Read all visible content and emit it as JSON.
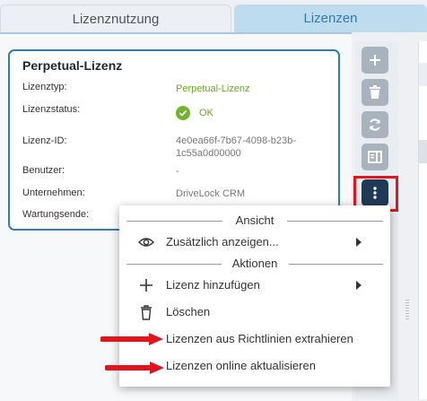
{
  "tabs": [
    {
      "label": "Lizenznutzung"
    },
    {
      "label": "Lizenzen"
    }
  ],
  "card": {
    "title": "Perpetual-Lizenz",
    "rows": [
      {
        "label": "Lizenztyp:",
        "value": "Perpetual-Lizenz"
      },
      {
        "label": "Lizenzstatus:",
        "value": "OK"
      },
      {
        "label": "Lizenz-ID:",
        "value": "4e0ea66f-7b67-4098-b23b-1c55a0d00000"
      },
      {
        "label": "Benutzer:",
        "value": "-"
      },
      {
        "label": "Unternehmen:",
        "value": "DriveLock CRM"
      },
      {
        "label": "Wartungsende:",
        "value": ""
      }
    ]
  },
  "toolbar": {
    "icons": [
      "plus-icon",
      "trash-icon",
      "refresh-icon",
      "panel-icon",
      "more-vertical-icon"
    ]
  },
  "menu": {
    "section_view": "Ansicht",
    "section_actions": "Aktionen",
    "items": [
      {
        "label": "Zusätzlich anzeigen...",
        "icon": "eye-icon",
        "submenu": true
      },
      {
        "label": "Lizenz hinzufügen",
        "icon": "plus-icon",
        "submenu": true
      },
      {
        "label": "Löschen",
        "icon": "trash-icon",
        "submenu": false
      },
      {
        "label": "Lizenzen aus Richtlinien extrahieren",
        "icon": "",
        "submenu": false
      },
      {
        "label": "Lizenzen online aktualisieren",
        "icon": "",
        "submenu": false
      }
    ]
  },
  "colors": {
    "accent": "#2e7db8",
    "ok_green": "#73b22e",
    "highlight_red": "#e3141c",
    "toolbar_dark": "#1f3a57"
  }
}
